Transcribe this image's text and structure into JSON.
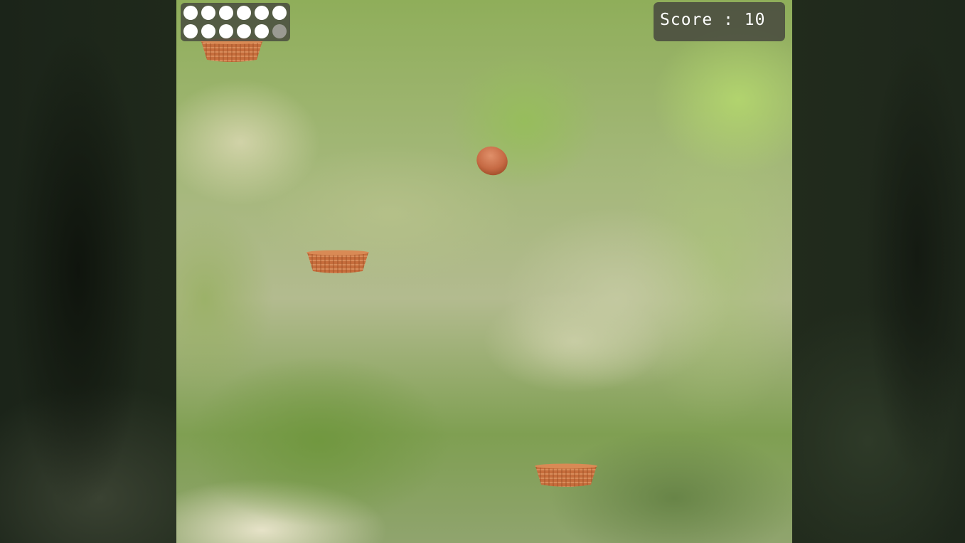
{
  "hud": {
    "lives": [
      true,
      true,
      true,
      true,
      true,
      true,
      true,
      true,
      true,
      true,
      true,
      false
    ],
    "score_label": "Score",
    "score_separator": " : ",
    "score_value": "10"
  },
  "objects": {
    "baskets": [
      "basket",
      "basket",
      "basket"
    ],
    "egg": "egg"
  },
  "colors": {
    "basket": "#c87040",
    "egg": "#c9704a",
    "life_active": "#ffffff",
    "life_lost": "#9a9a92"
  }
}
